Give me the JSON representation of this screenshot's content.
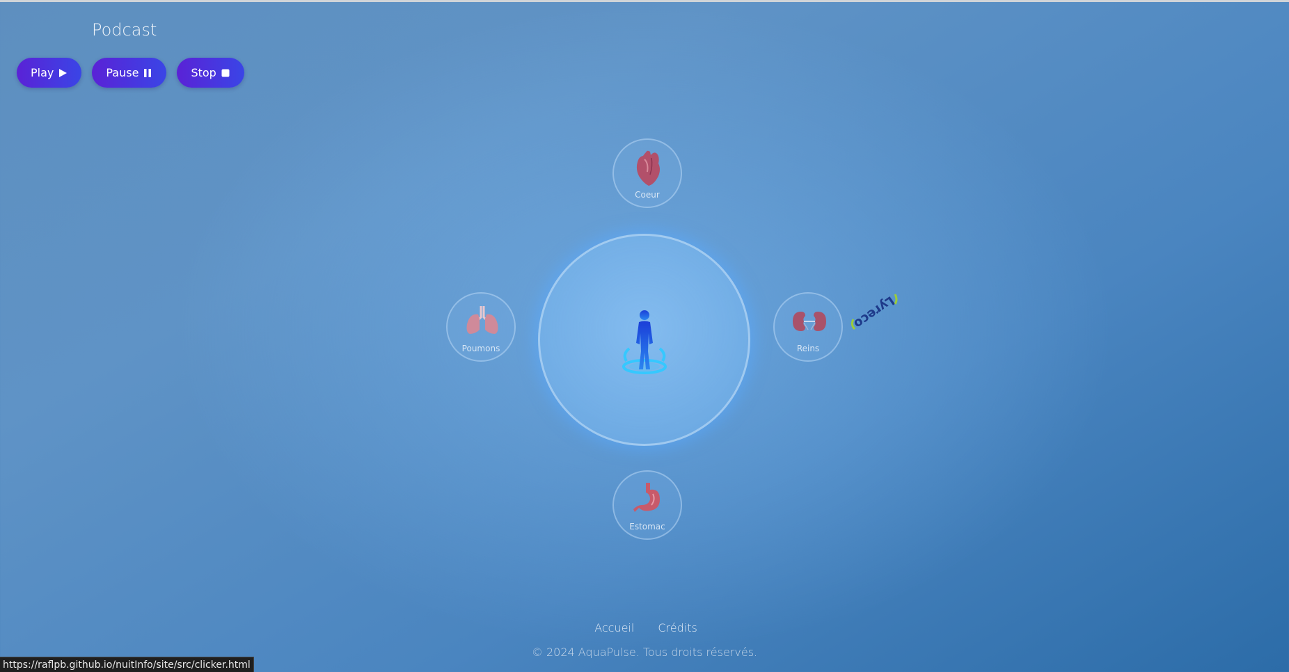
{
  "header": {
    "title": "Podcast"
  },
  "controls": {
    "play_label": "Play",
    "pause_label": "Pause",
    "stop_label": "Stop"
  },
  "organs": {
    "coeur": "Coeur",
    "poumons": "Poumons",
    "reins": "Reins",
    "estomac": "Estomac"
  },
  "logo": {
    "text": "Lyreco"
  },
  "footer": {
    "links": [
      "Accueil",
      "Crédits"
    ],
    "copyright": "© 2024 AquaPulse. Tous droits réservés."
  },
  "status_bar": {
    "url": "https://raflpb.github.io/nuitInfo/site/src/clicker.html"
  },
  "colors": {
    "button_gradient_start": "#5a22d6",
    "button_gradient_end": "#3a45e6",
    "figure_blue": "#1a5fe0",
    "glow_cyan": "#35c8ff"
  }
}
